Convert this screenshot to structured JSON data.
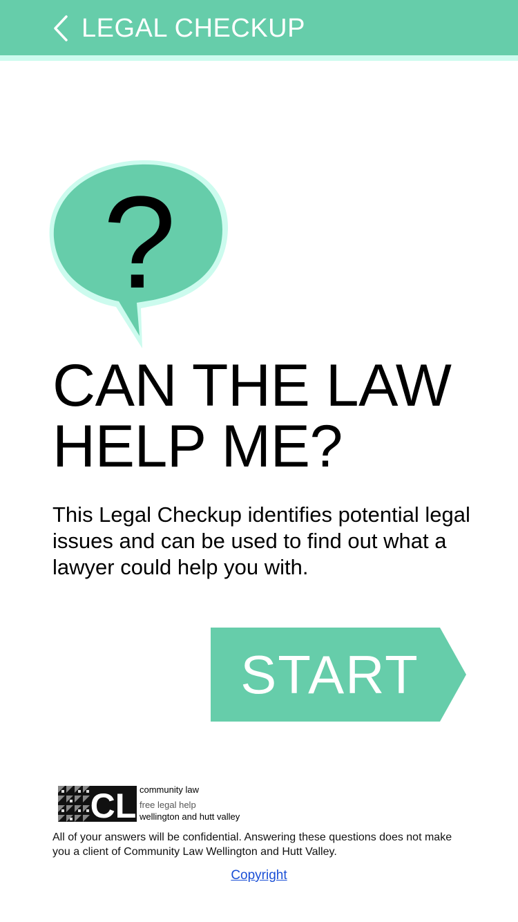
{
  "header": {
    "title": "LEGAL CHECKUP",
    "back_icon": "chevron-left-icon"
  },
  "hero": {
    "icon": "question-speech-bubble-icon",
    "icon_glyph": "?",
    "heading_line1": "CAN THE LAW",
    "heading_line2": "HELP ME?",
    "description": "This Legal Checkup identifies potential legal issues and can be used to find out what a lawyer could help you with."
  },
  "start_button": {
    "label": "START"
  },
  "footer": {
    "logo": {
      "mark_text": "CL",
      "name": "community law",
      "tagline": "free legal help",
      "region": "wellington and hutt valley"
    },
    "disclaimer": "All of your answers will be confidential. Answering these questions does not make you a client of Community Law Wellington and Hutt Valley.",
    "copyright_link": "Copyright"
  },
  "colors": {
    "accent": "#66cdaa",
    "accent_light": "#ccfbee",
    "link": "#1a4fd6"
  }
}
